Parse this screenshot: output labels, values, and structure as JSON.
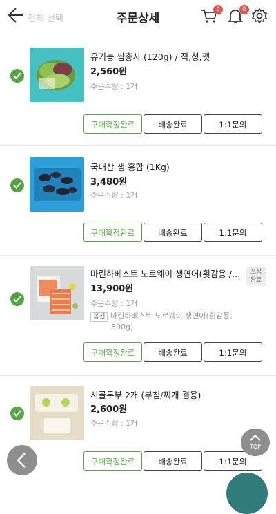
{
  "header": {
    "title": "주문상세",
    "select_all": "전체 선택",
    "cart_count": "0",
    "notif_count": "0"
  },
  "items": [
    {
      "name": "유기농 쌈총사 (120g) / 적,청,깻",
      "price": "2,560원",
      "qty": "주문수량 : 1개",
      "btn_confirm": "구매확정완료",
      "btn_delivery": "배송완료",
      "btn_inquiry": "1:1문의"
    },
    {
      "name": "국내산 생 홍합 (1Kg)",
      "price": "3,480원",
      "qty": "주문수량 : 1개",
      "btn_confirm": "구매확정완료",
      "btn_delivery": "배송완료",
      "btn_inquiry": "1:1문의"
    },
    {
      "name": "마린하베스트 노르웨이 생연어(횟감용 / …",
      "price": "13,900원",
      "qty": "주문수량 : 1개",
      "option_label": "옵션",
      "option_text_1": "마린하베스트 노르웨이 생연어(횟감용,",
      "option_text_2": "300g)",
      "packed_1": "포장",
      "packed_2": "완료",
      "btn_confirm": "구매확정완료",
      "btn_delivery": "배송완료",
      "btn_inquiry": "1:1문의"
    },
    {
      "name": "시골두부 2개 (부침/찌개 겸용)",
      "price": "2,600원",
      "qty": "주문수량 : 1개",
      "btn_confirm": "구매확정완료",
      "btn_delivery": "배송완료",
      "btn_inquiry": "1:1문의"
    }
  ],
  "floating": {
    "top_label": "TOP"
  },
  "colors": {
    "accent": "#55a544",
    "badge": "#e8534f"
  }
}
